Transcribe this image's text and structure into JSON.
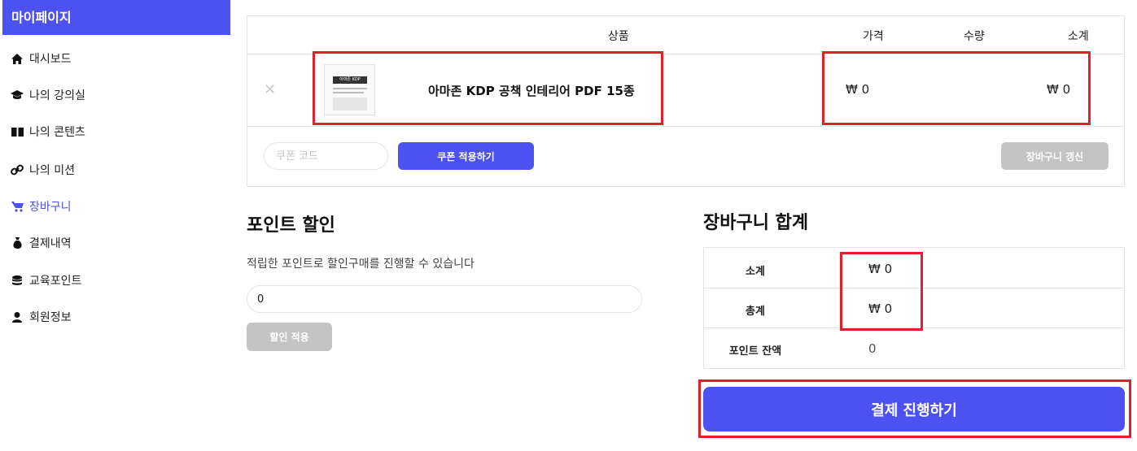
{
  "sidebar": {
    "title": "마이페이지",
    "items": [
      {
        "label": "대시보드",
        "icon": "home-icon"
      },
      {
        "label": "나의 강의실",
        "icon": "graduation-cap-icon"
      },
      {
        "label": "나의 콘텐츠",
        "icon": "book-icon"
      },
      {
        "label": "나의 미션",
        "icon": "link-icon"
      },
      {
        "label": "장바구니",
        "icon": "cart-icon"
      },
      {
        "label": "결제내역",
        "icon": "money-bag-icon"
      },
      {
        "label": "교육포인트",
        "icon": "coins-icon"
      },
      {
        "label": "회원정보",
        "icon": "user-icon"
      }
    ],
    "active_index": 4,
    "accent_color": "#4b52f0"
  },
  "cart": {
    "headers": {
      "product": "상품",
      "price": "가격",
      "quantity": "수량",
      "subtotal": "소계"
    },
    "items": [
      {
        "name": "아마존 KDP 공책 인테리어 PDF 15종",
        "thumb_title": "아마존 KDP",
        "price": "₩ 0",
        "subtotal": "₩ 0"
      }
    ],
    "coupon_placeholder": "쿠폰 코드",
    "apply_coupon": "쿠폰 적용하기",
    "update_cart": "장바구니 갱신"
  },
  "points": {
    "title": "포인트 할인",
    "description": "적립한 포인트로 할인구매를 진행할 수 있습니다",
    "value": "0",
    "apply": "할인 적용"
  },
  "totals": {
    "title": "장바구니 합계",
    "subtotal_label": "소계",
    "subtotal_value": "₩ 0",
    "total_label": "총계",
    "total_value": "₩ 0",
    "points_label": "포인트 잔액",
    "points_value": "0",
    "checkout": "결제 진행하기"
  },
  "colors": {
    "accent": "#4b52f0",
    "highlight": "#e0202a",
    "disabled": "#c4c4c4"
  }
}
